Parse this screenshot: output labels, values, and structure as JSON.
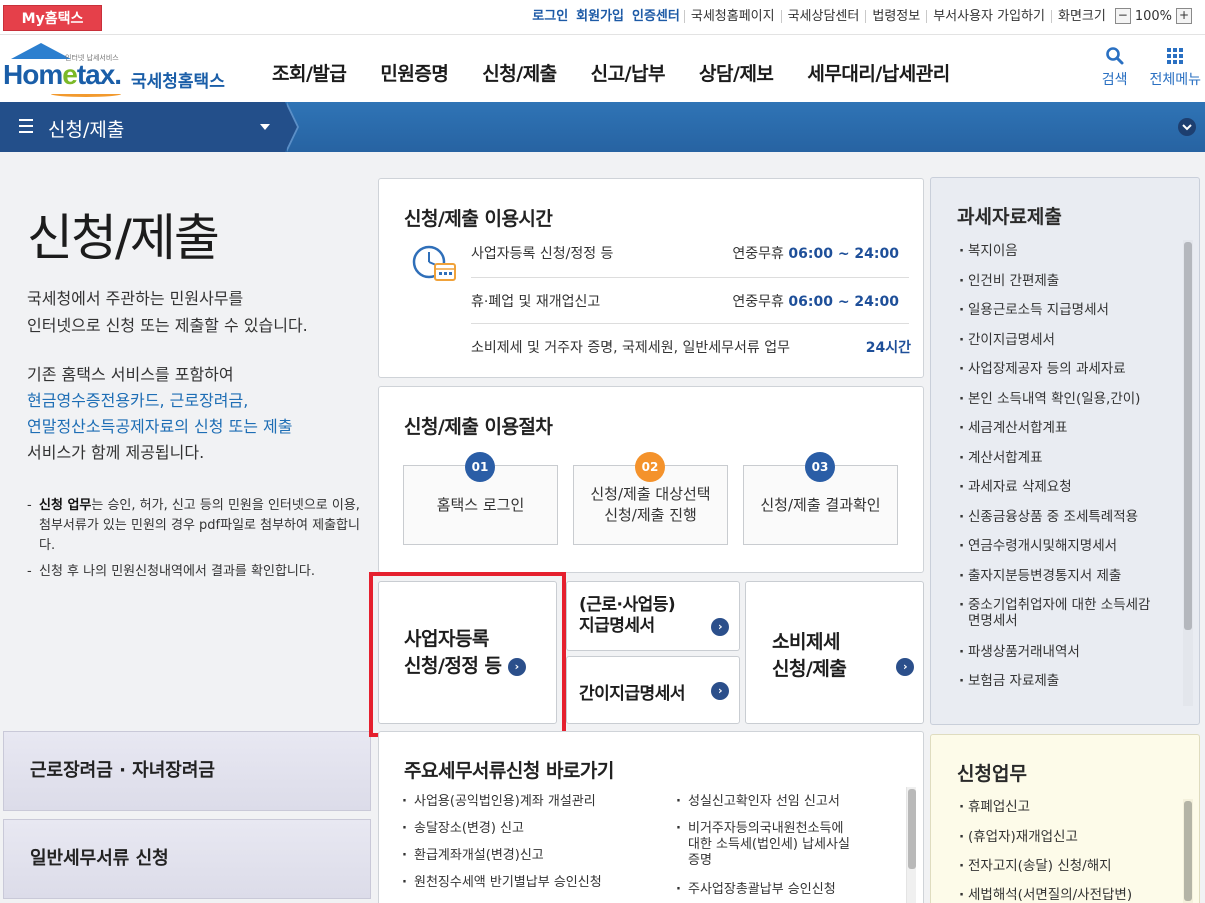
{
  "topbar": {
    "my_hometax": "My홈택스",
    "login": "로그인",
    "signup": "회원가입",
    "cert_center": "인증센터",
    "links": [
      "국세청홈페이지",
      "국세상담센터",
      "법령정보",
      "부서사용자 가입하기",
      "화면크기"
    ],
    "zoom_minus": "−",
    "zoom_value": "100%",
    "zoom_plus": "+"
  },
  "header": {
    "logo_slogan": "인터넷 납세서비스",
    "logo_word_a": "Hom",
    "logo_word_e": "e",
    "logo_word_b": "tax.",
    "logo_kor": "국세청홈택스",
    "nav": [
      "조회/발급",
      "민원증명",
      "신청/제출",
      "신고/납부",
      "상담/제보",
      "세무대리/납세관리"
    ],
    "search_label": "검색",
    "menu_label": "전체메뉴"
  },
  "location": {
    "title": "신청/제출"
  },
  "left": {
    "page_title": "신청/제출",
    "intro1_l1": "국세청에서 주관하는 민원사무를",
    "intro1_l2": "인터넷으로 신청 또는 제출할 수 있습니다.",
    "intro2_l1": "기존 홈택스 서비스를 포함하여",
    "intro2_l2": "현금영수증전용카드, 근로장려금,",
    "intro2_l3": "연말정산소득공제자료의 신청 또는 제출",
    "intro2_l4": "서비스가 함께 제공됩니다.",
    "note1_bold": "신청 업무",
    "note1_rest": "는 승인, 허가, 신고 등의 민원을 인터넷으로 이용, 첨부서류가 있는 민원의 경우 pdf파일로 첨부하여 제출합니다.",
    "note2": "신청 후 나의 민원신청내역에서 결과를 확인합니다.",
    "btn_incentive": "근로장려금 · 자녀장려금",
    "btn_general": "일반세무서류 신청"
  },
  "hours": {
    "title": "신청/제출 이용시간",
    "rows": [
      {
        "name": "사업자등록 신청/정정 등",
        "prefix": "연중무휴 ",
        "time": "06:00 ~ 24:00"
      },
      {
        "name": "휴·폐업 및 재개업신고",
        "prefix": "연중무휴 ",
        "time": "06:00 ~ 24:00"
      },
      {
        "name": "소비제세 및 거주자 증명, 국제세원, 일반세무서류 업무",
        "prefix": "",
        "time": "24시간"
      }
    ]
  },
  "procedure": {
    "title": "신청/제출 이용절차",
    "steps": [
      {
        "num": "01",
        "l1": "홈택스 로그인",
        "l2": ""
      },
      {
        "num": "02",
        "l1": "신청/제출 대상선택",
        "l2": "신청/제출 진행"
      },
      {
        "num": "03",
        "l1": "신청/제출 결과확인",
        "l2": ""
      }
    ],
    "colors": {
      "blue": "#2a5da6",
      "orange": "#f4922b"
    }
  },
  "tiles": {
    "biz_l1": "사업자등록",
    "biz_l2": "신청/정정 등",
    "pay_l1": "(근로·사업등)",
    "pay_l2": "지급명세서",
    "simple": "간이지급명세서",
    "excise_l1": "소비제세",
    "excise_l2": "신청/제출"
  },
  "shortcuts": {
    "title": "주요세무서류신청 바로가기",
    "left": [
      "사업용(공익법인용)계좌 개설관리",
      "송달장소(변경) 신고",
      "환급계좌개설(변경)신고",
      "원천징수세액 반기별납부 승인신청"
    ],
    "right_1": "성실신고확인자 선임 신고서",
    "right_2_l1": "비거주자등의국내원천소득에",
    "right_2_l2": "대한 소득세(법인세) 납세사실",
    "right_2_l3": "증명",
    "right_3": "주사업장총괄납부 승인신청"
  },
  "tax_panel": {
    "title": "과세자료제출",
    "items": [
      "복지이음",
      "인건비 간편제출",
      "일용근로소득 지급명세서",
      "간이지급명세서",
      "사업장제공자 등의 과세자료",
      "본인 소득내역 확인(일용,간이)",
      "세금계산서합계표",
      "계산서합계표",
      "과세자료 삭제요청",
      "신종금융상품 중 조세특례적용",
      "연금수령개시및해지명세서",
      "출자지분등변경통지서 제출"
    ],
    "item_long_l1": "중소기업취업자에 대한 소득세감",
    "item_long_l2": "면명세서",
    "items_after": [
      "파생상품거래내역서",
      "보험금 자료제출"
    ]
  },
  "apply_panel": {
    "title": "신청업무",
    "items": [
      "휴폐업신고",
      "(휴업자)재개업신고",
      "전자고지(송달) 신청/해지",
      "세법해석(서면질의/사전답변)"
    ]
  }
}
